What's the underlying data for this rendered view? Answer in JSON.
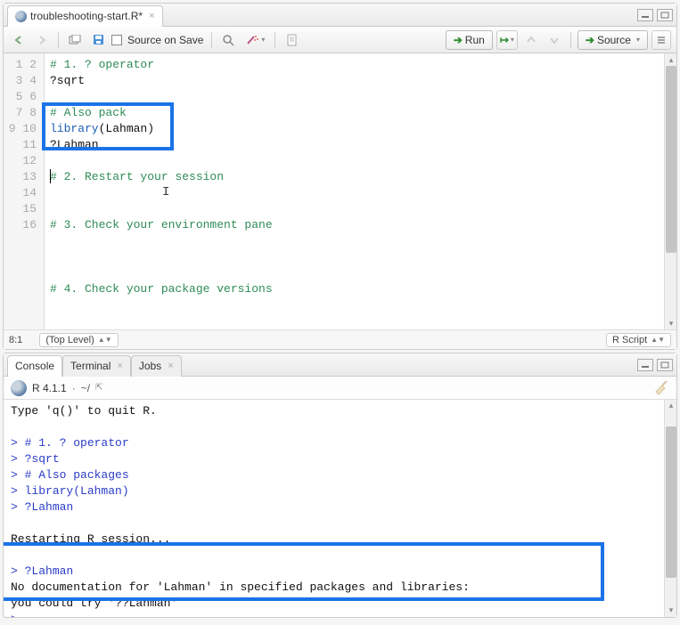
{
  "source": {
    "tab_filename": "troubleshooting-start.R*",
    "source_on_save_label": "Source on Save",
    "run_label": "Run",
    "source_btn_label": "Source",
    "gutter": [
      "1",
      "2",
      "3",
      "4",
      "5",
      "6",
      "7",
      "8",
      "9",
      "10",
      "11",
      "12",
      "13",
      "14",
      "15",
      "16"
    ],
    "lines": {
      "l1_comment": "# 1. ? operator",
      "l2": "?sqrt",
      "l3": "",
      "l4_comment_visible": "# Also pack",
      "l5_kw": "library",
      "l5_rest": "(Lahman)",
      "l6": "?Lahman",
      "l7": "",
      "l8_comment": "# 2. Restart your session",
      "l9": "",
      "l10": "",
      "l11_comment": "# 3. Check your environment pane",
      "l12": "",
      "l13": "",
      "l14": "",
      "l15_comment": "# 4. Check your package versions",
      "l16": ""
    },
    "status": {
      "pos": "8:1",
      "scope": "(Top Level)",
      "type": "R Script"
    }
  },
  "console": {
    "tabs": {
      "console": "Console",
      "terminal": "Terminal",
      "jobs": "Jobs"
    },
    "version": "R 4.1.1",
    "wd": "~/",
    "lines": {
      "quit": "Type 'q()' to quit R.",
      "c1": "# 1. ? operator",
      "c2": "?sqrt",
      "c3": "# Also packages",
      "c4": "library(Lahman)",
      "c5": "?Lahman",
      "restart": "Restarting R session...",
      "q1": "?Lahman",
      "q2": "No documentation for 'Lahman' in specified packages and libraries:",
      "q3": "you could try '??Lahman'"
    }
  }
}
